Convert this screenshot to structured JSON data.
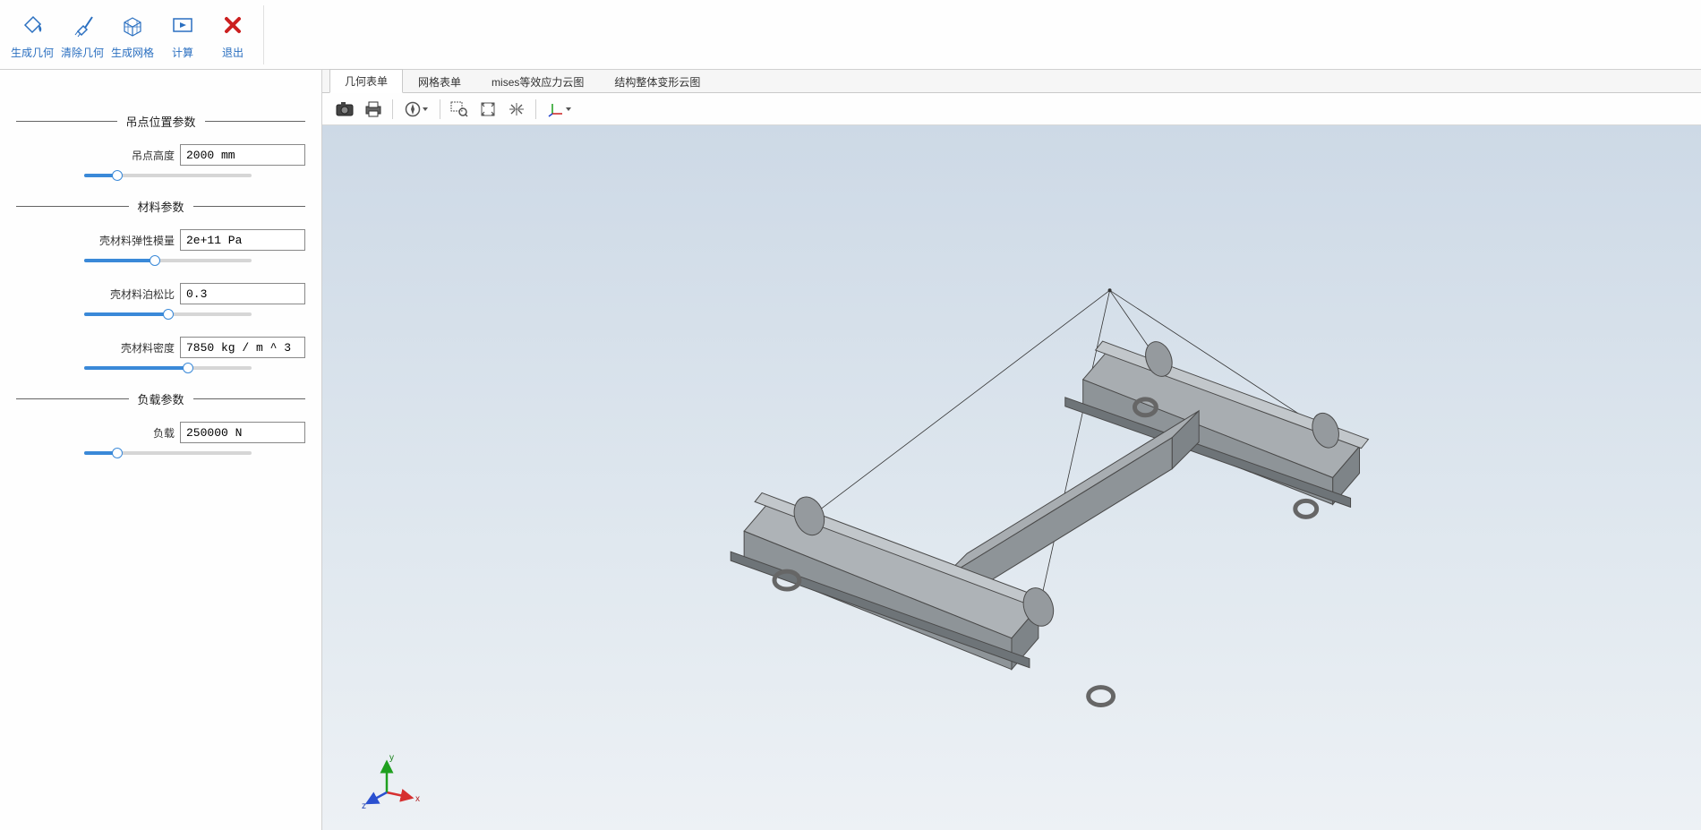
{
  "toolbar": {
    "gen_geom": "生成几何",
    "clear_geom": "清除几何",
    "gen_mesh": "生成网格",
    "compute": "计算",
    "exit": "退出"
  },
  "sidebar": {
    "sections": {
      "lift": "吊点位置参数",
      "material": "材料参数",
      "load": "负载参数"
    },
    "params": {
      "lift_height_label": "吊点高度",
      "lift_height_value": "2000 mm",
      "lift_height_pct": 20,
      "modulus_label": "壳材料弹性模量",
      "modulus_value": "2e+11 Pa",
      "modulus_pct": 42,
      "poisson_label": "壳材料泊松比",
      "poisson_value": "0.3",
      "poisson_pct": 50,
      "density_label": "壳材料密度",
      "density_value": "7850 kg / m ^ 3",
      "density_pct": 62,
      "load_label": "负载",
      "load_value": "250000 N",
      "load_pct": 20
    }
  },
  "tabs": {
    "geom": "几何表单",
    "mesh": "网格表单",
    "mises": "mises等效应力云图",
    "deform": "结构整体变形云图"
  },
  "triad": {
    "x": "x",
    "y": "y",
    "z": "z"
  }
}
